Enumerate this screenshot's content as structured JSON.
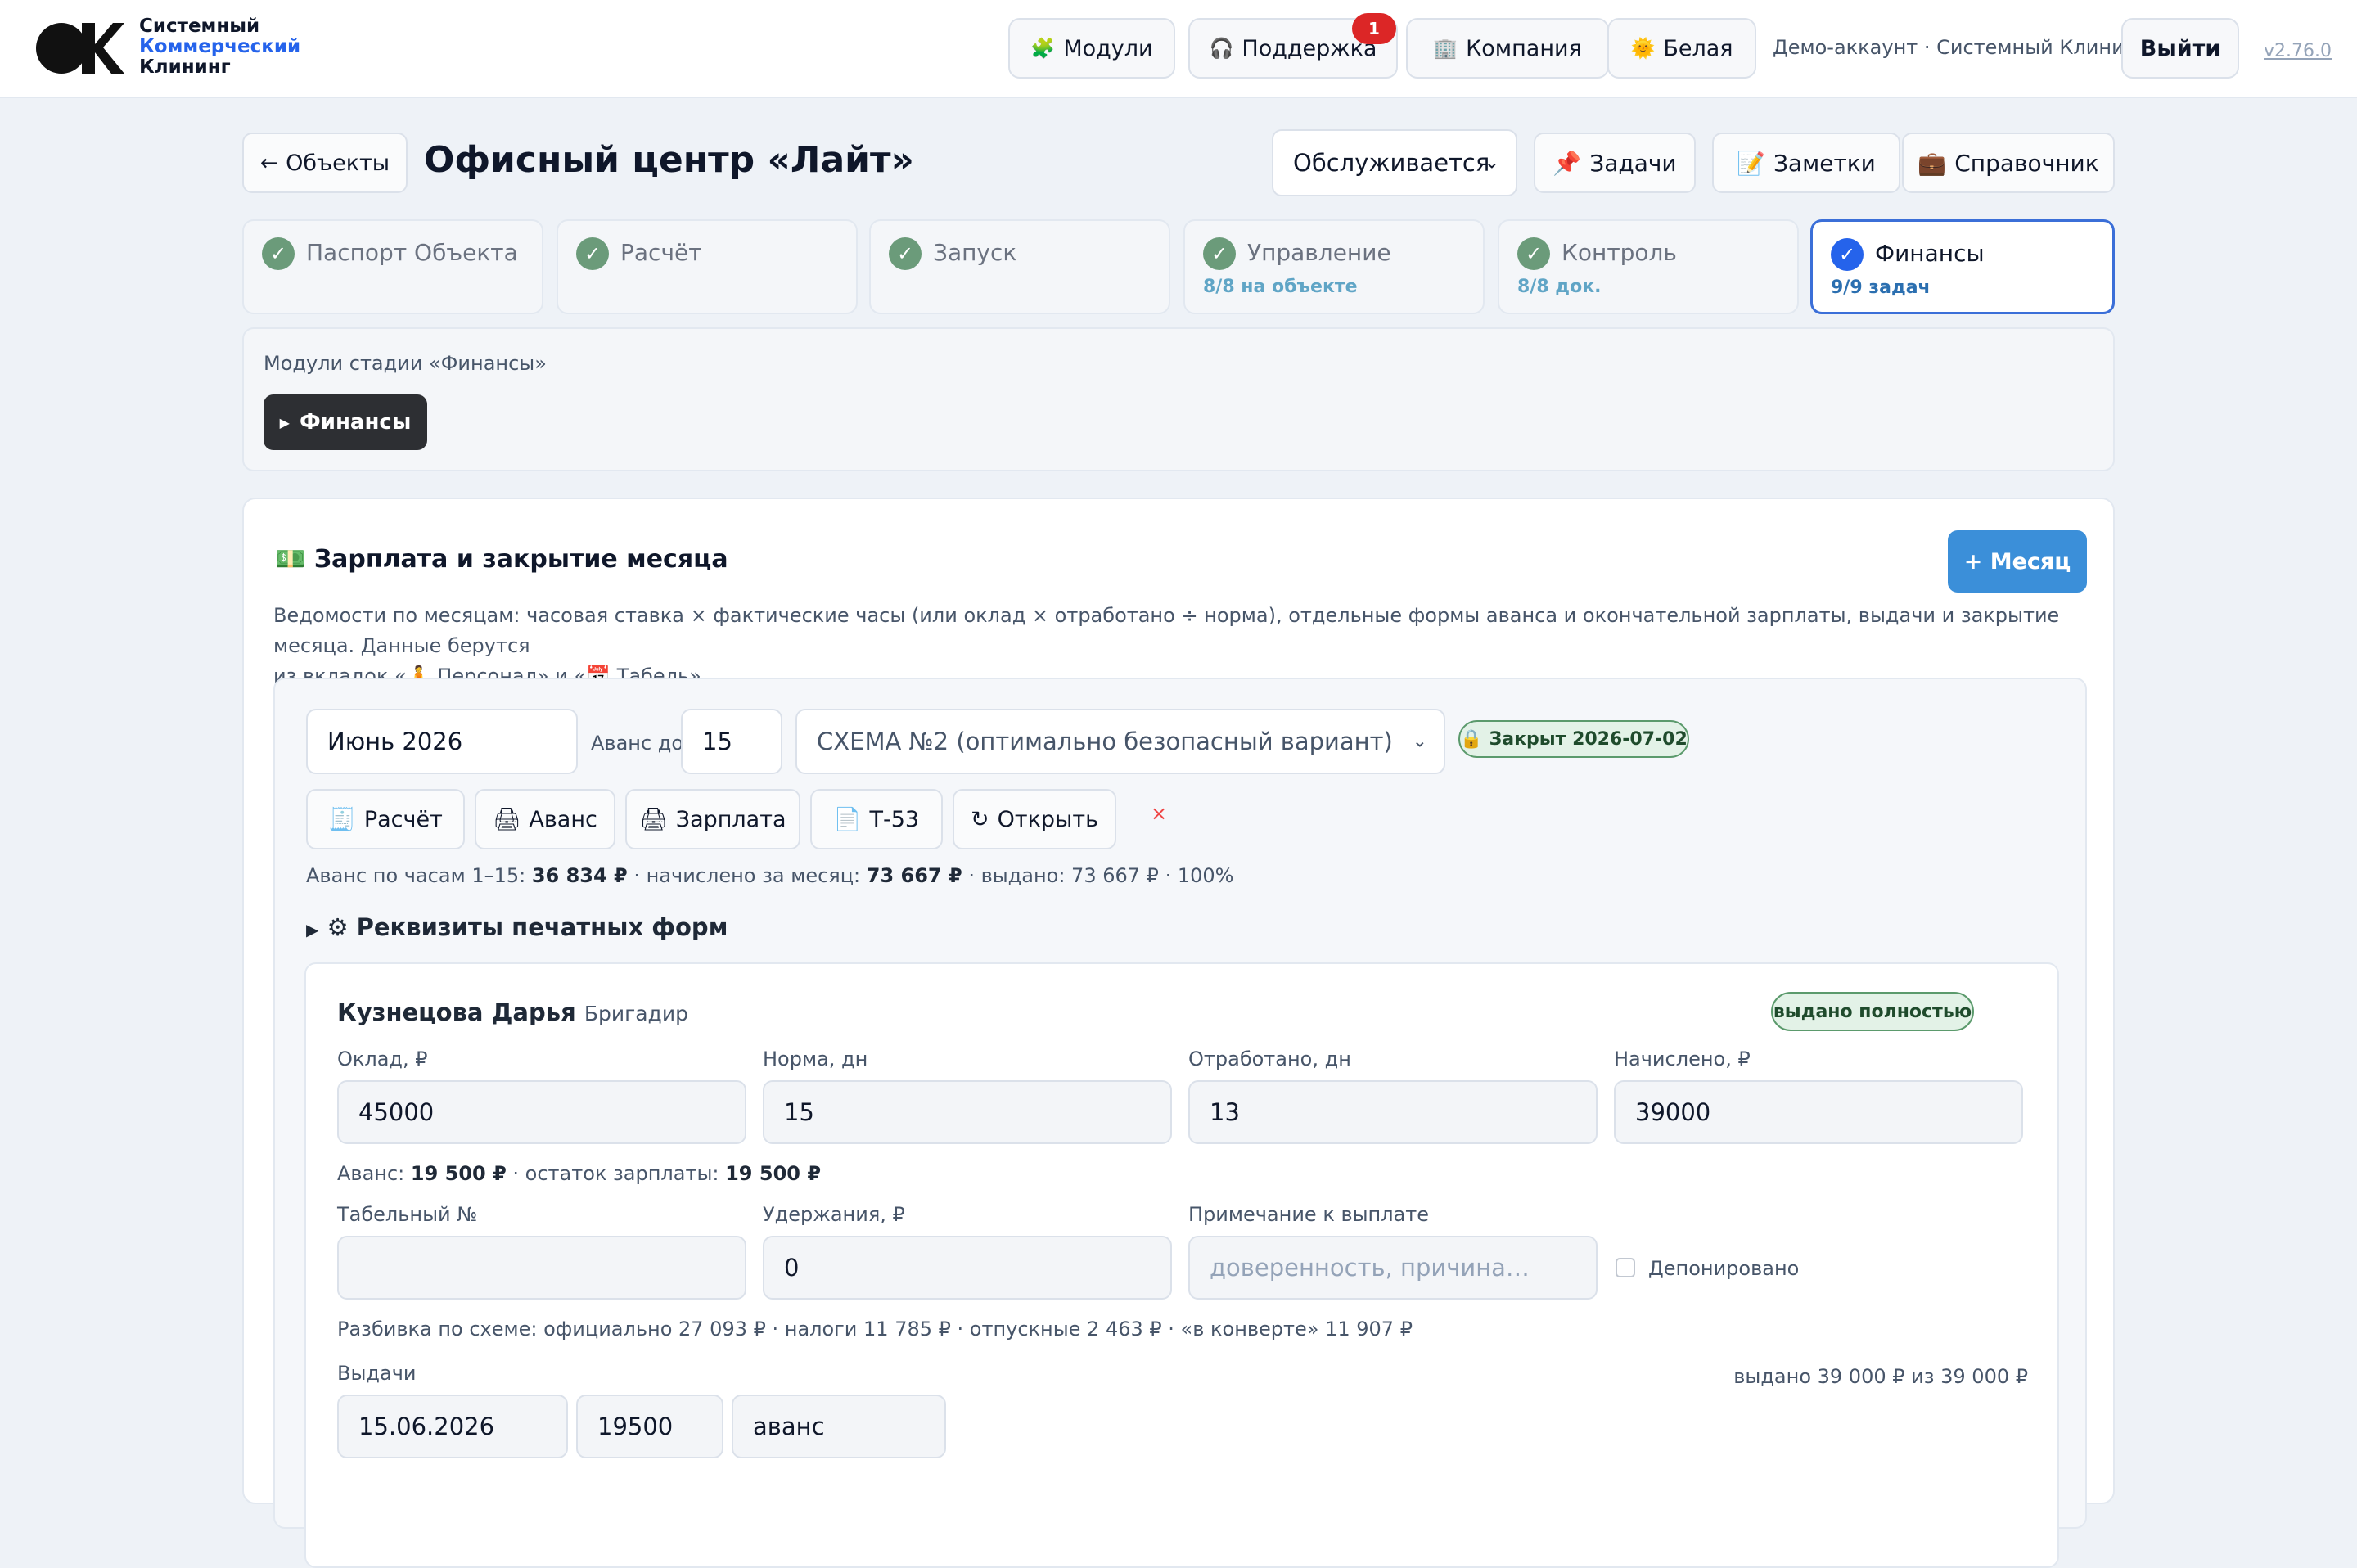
{
  "brand": {
    "line1": "Системный",
    "line2": "Коммерческий",
    "line3": "Клининг"
  },
  "topnav": {
    "modules": "Модули",
    "support": "Поддержка",
    "support_badge": "1",
    "company": "Компания",
    "theme": "Белая",
    "account": "Демо-аккаунт · Системный Клининг",
    "logout": "Выйти",
    "version": "v2.76.0"
  },
  "header": {
    "back": "← Объекты",
    "title": "Офисный центр «Лайт»",
    "status": "Обслуживается",
    "tasks": "Задачи",
    "notes": "Заметки",
    "directory": "Справочник"
  },
  "stages": [
    {
      "label": "Паспорт Объекта",
      "sub": ""
    },
    {
      "label": "Расчёт",
      "sub": ""
    },
    {
      "label": "Запуск",
      "sub": ""
    },
    {
      "label": "Управление",
      "sub": "8/8 на объекте"
    },
    {
      "label": "Контроль",
      "sub": "8/8 док."
    },
    {
      "label": "Финансы",
      "sub": "9/9 задач"
    }
  ],
  "modules": {
    "title": "Модули стадии «Финансы»",
    "button": "Финансы"
  },
  "salary": {
    "title": "Зарплата и закрытие месяца",
    "add_month": "+ Месяц",
    "desc_a": "Ведомости по месяцам: часовая ставка × фактические часы (или оклад × отработано ÷ норма), отдельные формы аванса и окончательной зарплаты, выдачи и закрытие месяца. Данные берутся",
    "desc_b": "из вкладок «",
    "desc_c": " Персонал» и «",
    "desc_d": " Табель».",
    "month": "Июнь 2026",
    "advance_until_label": "Аванс до",
    "advance_until": "15",
    "scheme": "СХЕМА №2 (оптимально безопасный вариант)",
    "closed_badge": "Закрыт 2026-07-02",
    "actions": {
      "calc": "Расчёт",
      "advance": "Аванс",
      "salary": "Зарплата",
      "t53": "Т-53",
      "open": "Открыть",
      "delete": "×"
    },
    "summary": {
      "p1": "Аванс по часам 1–15: ",
      "advance": "36 834 ₽",
      "p2": " · начислено за месяц: ",
      "accrued": "73 667 ₽",
      "p3": " · выдано: 73 667 ₽ · 100%"
    },
    "print_forms": "Реквизиты печатных форм"
  },
  "employee": {
    "name": "Кузнецова Дарья",
    "role": "Бригадир",
    "status": "выдано полностью",
    "salary_label": "Оклад, ₽",
    "salary": "45000",
    "norm_label": "Норма, дн",
    "norm": "15",
    "worked_label": "Отработано, дн",
    "worked": "13",
    "accrued_label": "Начислено, ₽",
    "accrued": "39000",
    "advance_note_a": "Аванс: ",
    "advance_note_b": "19 500 ₽",
    "advance_note_c": " · остаток зарплаты: ",
    "advance_note_d": "19 500 ₽",
    "tab_label": "Табельный №",
    "tab_value": "",
    "deduct_label": "Удержания, ₽",
    "deduct": "0",
    "note_label": "Примечание к выплате",
    "note_placeholder": "доверенность, причина…",
    "deposited": "Депонировано",
    "breakdown": "Разбивка по схеме: официально 27 093 ₽ · налоги 11 785 ₽ · отпускные 2 463 ₽ · «в конверте» 11 907 ₽",
    "payouts_label": "Выдачи",
    "payouts_total": "выдано 39 000 ₽ из 39 000 ₽",
    "payouts": [
      {
        "date": "15.06.2026",
        "amount": "19500",
        "type": "аванс"
      }
    ]
  },
  "icons": {
    "modules": "puzzle-icon",
    "support": "headphones-icon",
    "company": "building-icon",
    "theme": "sun-icon",
    "tasks": "pin-icon",
    "notes": "memo-icon",
    "directory": "briefcase-icon",
    "salary": "money-icon",
    "lock": "lock-icon",
    "check": "check-icon",
    "gear": "gear-icon"
  },
  "colors": {
    "accent": "#3b8fd9",
    "primary": "#2563eb",
    "success_bg": "#e3f2e7",
    "danger": "#dc2626"
  }
}
